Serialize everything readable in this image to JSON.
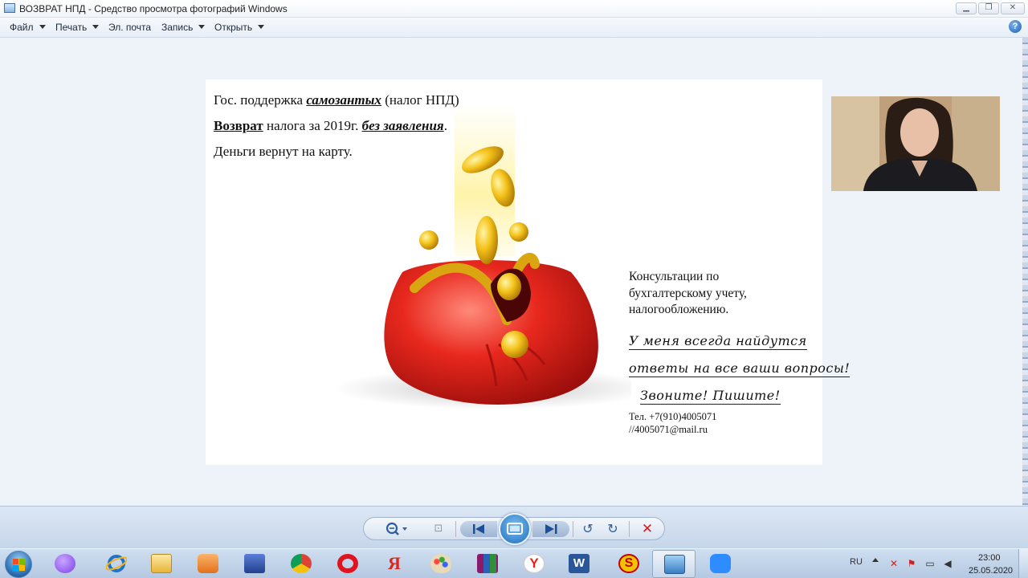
{
  "window": {
    "title": "ВОЗВРАТ НПД - Средство просмотра фотографий Windows",
    "minimize_glyph": "▁",
    "maximize_glyph": "❐",
    "close_glyph": "✕"
  },
  "menu": {
    "items": [
      {
        "label": "Файл",
        "has_dropdown": true
      },
      {
        "label": "Печать",
        "has_dropdown": true
      },
      {
        "label": "Эл. почта",
        "has_dropdown": false
      },
      {
        "label": "Запись",
        "has_dropdown": true
      },
      {
        "label": "Открыть",
        "has_dropdown": true
      }
    ],
    "help_glyph": "?"
  },
  "photo": {
    "line1": {
      "a": "Гос. поддержка ",
      "b": "самозантых",
      "c": " (налог НПД)"
    },
    "line2": {
      "a": "Возврат",
      "b": " налога за 2019г.  ",
      "c": "без заявления",
      "d": "."
    },
    "line3": "Деньги вернут на карту.",
    "consult": [
      "Консультации по",
      "бухгалтерскому учету,",
      "налогообложению."
    ],
    "handwritten": [
      "У меня всегда найдутся",
      "ответы на все ваши вопросы!",
      "Звоните!  Пишите!"
    ],
    "phone": "Тел. +7(910)4005071",
    "email": "//4005071@mail.ru"
  },
  "controls": {
    "fit_glyph": "⊡",
    "rotate_left_glyph": "↺",
    "rotate_right_glyph": "↻",
    "delete_glyph": "✕"
  },
  "taskbar": {
    "apps": [
      "alice-icon",
      "internet-explorer-icon",
      "file-explorer-icon",
      "media-player-icon",
      "save-floppy-icon",
      "chrome-icon",
      "opera-icon",
      "yandex-icon",
      "paint-icon",
      "winrar-icon",
      "yandex-browser-icon",
      "word-icon",
      "s-app-icon",
      "photo-viewer-icon",
      "zoom-icon"
    ],
    "active_app": "photo-viewer-icon",
    "language": "RU",
    "time": "23:00",
    "date": "25.05.2020"
  },
  "colors": {
    "wallet_red": "#e02020",
    "coin_gold": "#f4c21a",
    "accent_blue": "#1d6cc0"
  }
}
